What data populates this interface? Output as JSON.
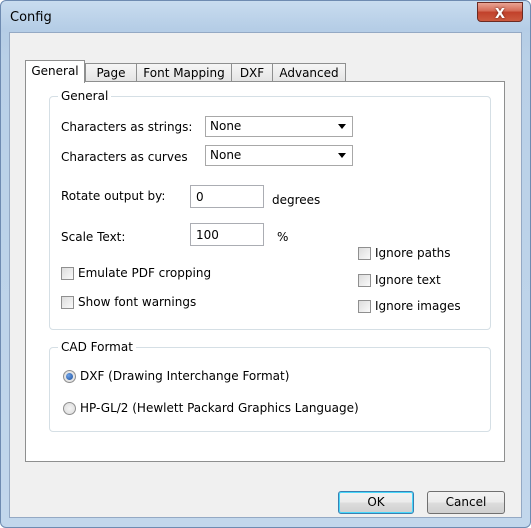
{
  "window": {
    "title": "Config",
    "close_glyph": "X"
  },
  "tabs": [
    {
      "label": "General",
      "active": true
    },
    {
      "label": "Page"
    },
    {
      "label": "Font Mapping"
    },
    {
      "label": "DXF"
    },
    {
      "label": "Advanced"
    }
  ],
  "general": {
    "legend": "General",
    "chars_as_strings": {
      "label": "Characters as strings:",
      "value": "None"
    },
    "chars_as_curves": {
      "label": "Characters as curves",
      "value": "None"
    },
    "rotate": {
      "label": "Rotate output by:",
      "value": "0",
      "unit": "degrees"
    },
    "scale": {
      "label": "Scale Text:",
      "value": "100",
      "unit": "%"
    },
    "checkboxes": {
      "emulate_pdf": "Emulate PDF cropping",
      "font_warnings": "Show font warnings",
      "ignore_paths": "Ignore paths",
      "ignore_text": "Ignore text",
      "ignore_images": "Ignore images"
    }
  },
  "cad": {
    "legend": "CAD Format",
    "options": [
      {
        "label": "DXF (Drawing Interchange Format)",
        "selected": true
      },
      {
        "label": "HP-GL/2 (Hewlett Packard Graphics Language)",
        "selected": false
      }
    ]
  },
  "buttons": {
    "ok": "OK",
    "cancel": "Cancel"
  }
}
